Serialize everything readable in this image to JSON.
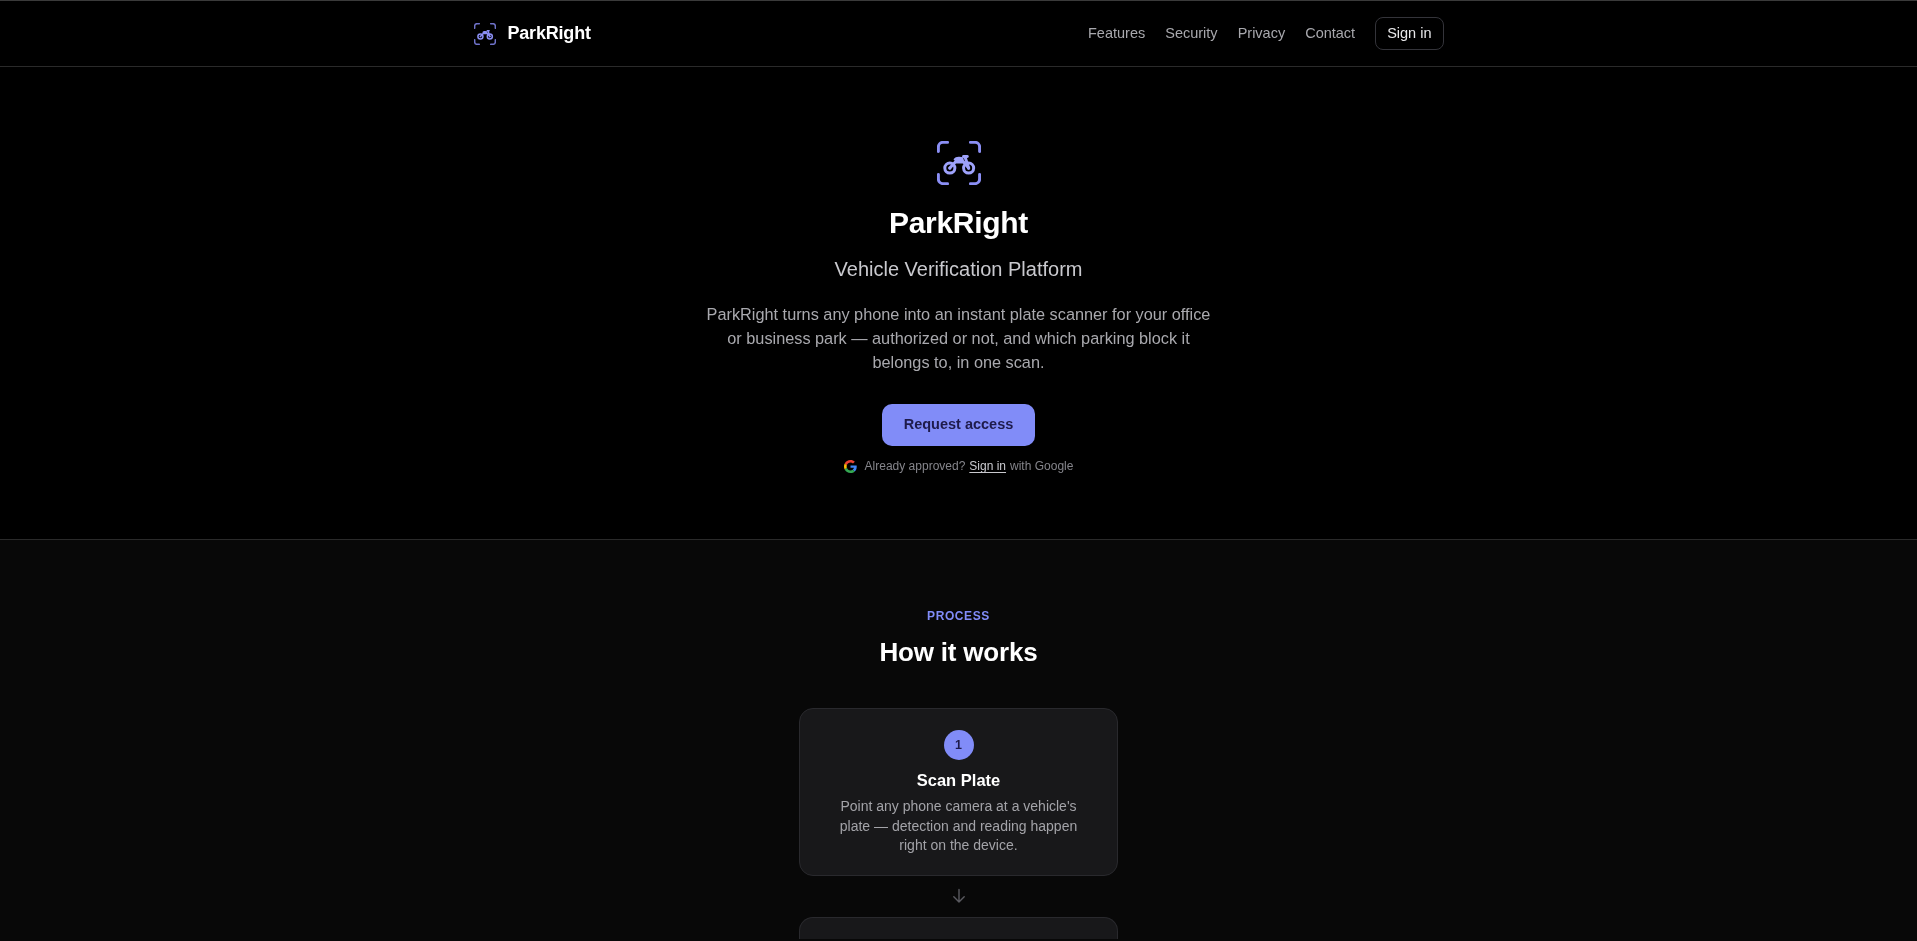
{
  "navbar": {
    "brand": "ParkRight",
    "links": [
      "Features",
      "Security",
      "Privacy",
      "Contact"
    ],
    "sign_in_button": "Sign in"
  },
  "hero": {
    "title": "ParkRight",
    "subtitle": "Vehicle Verification Platform",
    "description": "ParkRight turns any phone into an instant plate scanner for your office or business park — authorized or not, and which parking block it belongs to, in one scan.",
    "primary_button": "Request access",
    "sign_in_note": {
      "prefix": "Already approved?",
      "link": "Sign in",
      "suffix": "with Google"
    }
  },
  "process": {
    "eyebrow": "PROCESS",
    "heading": "How it works",
    "steps": [
      {
        "kind": "full",
        "number": "1",
        "title": "Scan Plate",
        "description": "Point any phone camera at a vehicle's plate — detection and reading happen right on the device."
      },
      {
        "kind": "cut_off"
      }
    ]
  }
}
